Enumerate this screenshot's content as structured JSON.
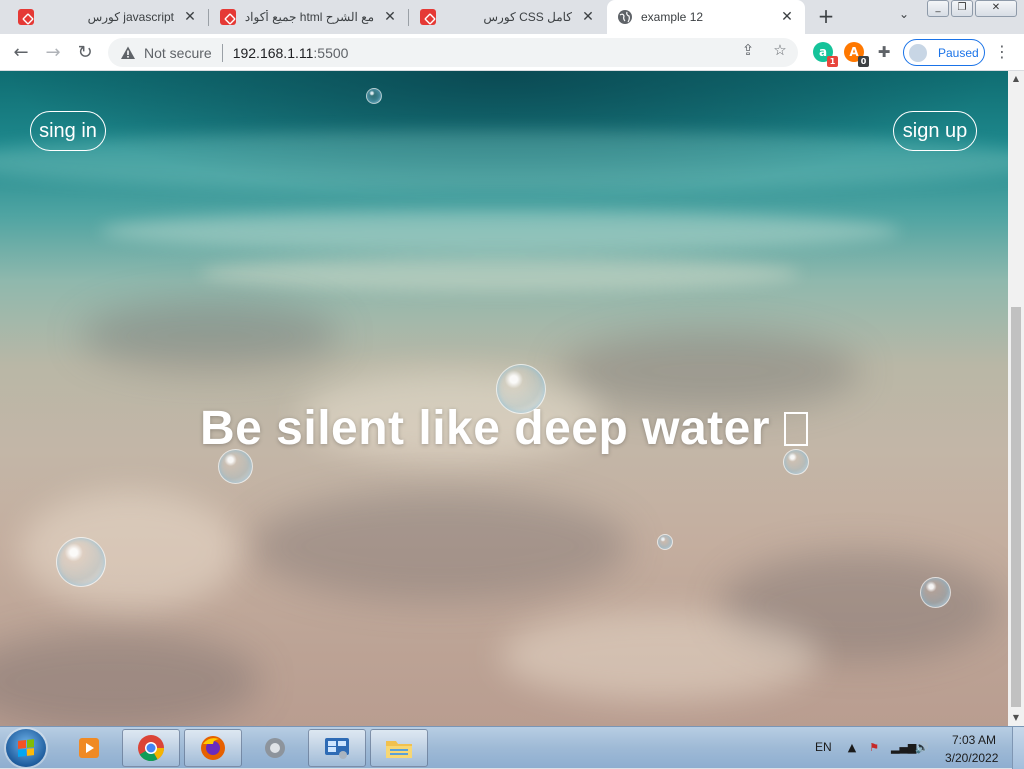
{
  "browser": {
    "tabs": [
      {
        "title": "كورس javascript",
        "favicon": "red-app-icon",
        "active": false
      },
      {
        "title": "جميع أكواد html مع الشرح",
        "favicon": "red-app-icon",
        "active": false
      },
      {
        "title": "كورس CSS كامل",
        "favicon": "red-app-icon",
        "active": false
      },
      {
        "title": "example 12",
        "favicon": "globe-icon",
        "active": true
      }
    ],
    "address": {
      "security_label": "Not secure",
      "host": "192.168.1.11",
      "port": ":5500"
    },
    "extensions": [
      {
        "icon": "grammar-extension-icon",
        "badge": "1",
        "color": "#15c39a",
        "badge_color": "#e8453c"
      },
      {
        "icon": "avast-extension-icon",
        "badge": "0",
        "color": "#ff7800",
        "badge_color": "#3c4043"
      }
    ],
    "profile_label": "Paused"
  },
  "page": {
    "signin_label": "sing in",
    "signup_label": "sign up",
    "headline": "Be silent like deep water",
    "accent_text_color": "#ffffff"
  },
  "taskbar": {
    "language": "EN",
    "time": "7:03 AM",
    "date": "3/20/2022",
    "apps": [
      "media-player-icon",
      "chrome-icon",
      "firefox-icon",
      "settings-gear-icon",
      "control-panel-icon",
      "file-explorer-icon"
    ]
  }
}
